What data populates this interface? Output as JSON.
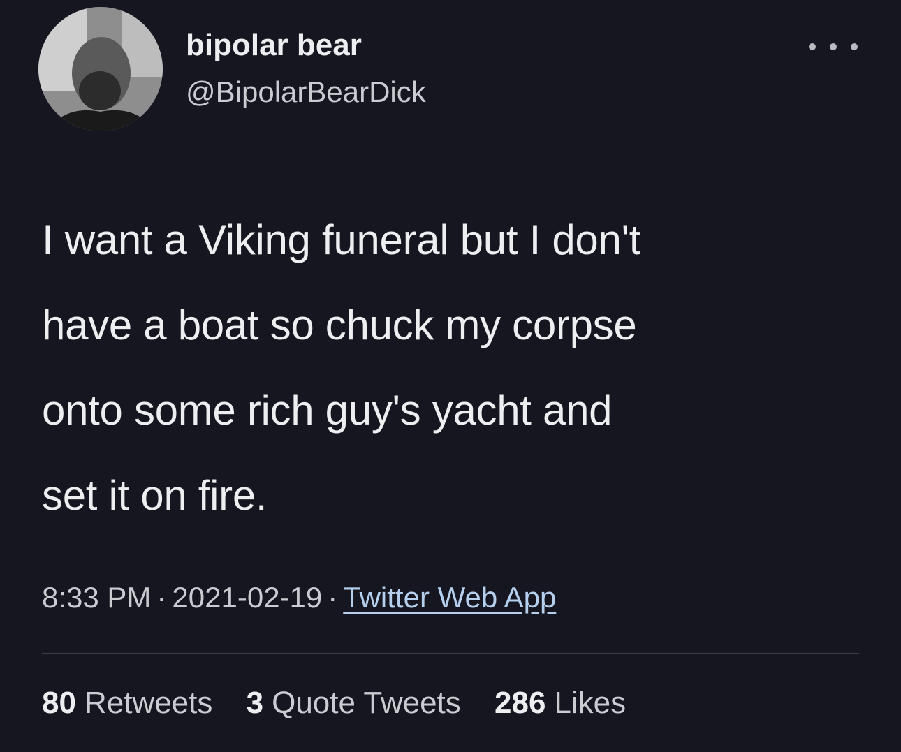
{
  "user": {
    "display_name": "bipolar bear",
    "handle": "@BipolarBearDick"
  },
  "tweet": {
    "lines": [
      "I want a Viking funeral but I don't",
      "have a boat so chuck my corpse",
      "onto some rich guy's yacht and",
      "set it on fire."
    ]
  },
  "meta": {
    "time": "8:33 PM",
    "date": "2021-02-19",
    "source": "Twitter Web App",
    "separator": "·"
  },
  "stats": {
    "retweets_count": "80",
    "retweets_label": "Retweets",
    "quotes_count": "3",
    "quotes_label": "Quote Tweets",
    "likes_count": "286",
    "likes_label": "Likes"
  },
  "icons": {
    "more": "more-horizontal-icon"
  },
  "colors": {
    "background": "#15161f",
    "text": "#eceef0",
    "secondary_text": "#c9ccd0",
    "link": "#b5d0ee"
  }
}
